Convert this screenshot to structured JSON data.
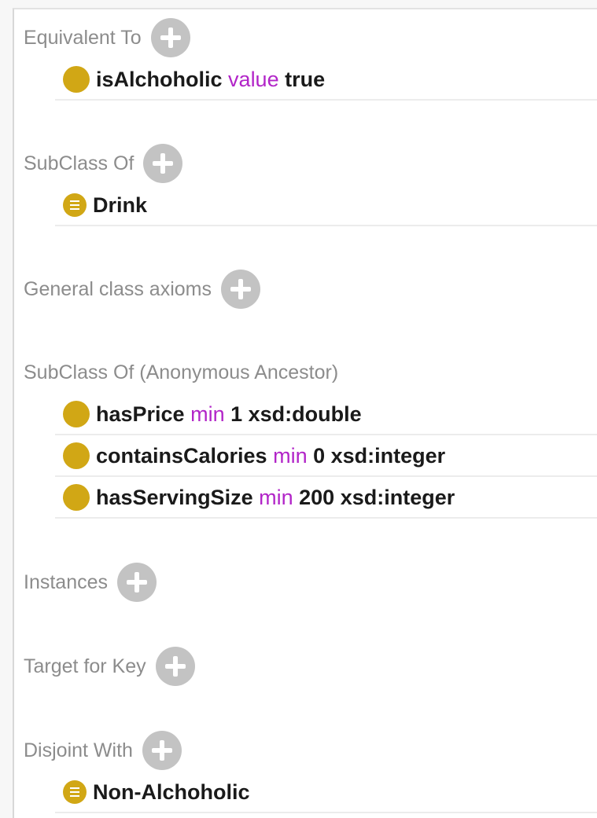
{
  "sections": {
    "equivalent_to": {
      "title": "Equivalent To",
      "items": [
        {
          "icon": "restriction-dot-icon",
          "property": "isAlchoholic",
          "keyword": "value",
          "filler": "true"
        }
      ]
    },
    "subclass_of": {
      "title": "SubClass Of",
      "items": [
        {
          "icon": "class-icon",
          "label": "Drink"
        }
      ]
    },
    "general_class_axioms": {
      "title": "General class axioms"
    },
    "anonymous_ancestor": {
      "title": "SubClass Of (Anonymous Ancestor)",
      "items": [
        {
          "icon": "restriction-dot-icon",
          "property": "hasPrice",
          "keyword": "min",
          "filler": "1 xsd:double"
        },
        {
          "icon": "restriction-dot-icon",
          "property": "containsCalories",
          "keyword": "min",
          "filler": "0 xsd:integer"
        },
        {
          "icon": "restriction-dot-icon",
          "property": "hasServingSize",
          "keyword": "min",
          "filler": "200 xsd:integer"
        }
      ]
    },
    "instances": {
      "title": "Instances"
    },
    "target_for_key": {
      "title": "Target for Key"
    },
    "disjoint_with": {
      "title": "Disjoint With",
      "items": [
        {
          "icon": "class-icon",
          "label": "Non-Alchoholic"
        }
      ]
    }
  },
  "colors": {
    "icon_gold": "#d1a715",
    "keyword_purple": "#b225c8",
    "header_gray": "#8c8c8c",
    "add_button_gray": "#c3c3c3"
  }
}
